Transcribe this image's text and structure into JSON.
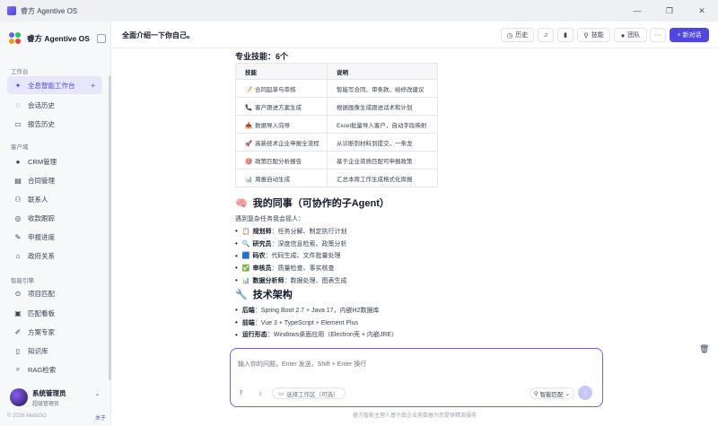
{
  "window": {
    "title": "睿方 Agentive OS"
  },
  "brand": {
    "name": "睿方 Agentive OS"
  },
  "sidebar": {
    "section1": "工作台",
    "section2": "客户域",
    "section3": "智能引擎",
    "items": [
      {
        "label": "全息智能工作台",
        "icon": "sparkle-icon",
        "active": true
      },
      {
        "label": "会话历史",
        "icon": "chat-icon"
      },
      {
        "label": "报告历史",
        "icon": "document-icon"
      },
      {
        "label": "CRM管理",
        "icon": "person-icon"
      },
      {
        "label": "合同管理",
        "icon": "contract-icon"
      },
      {
        "label": "联系人",
        "icon": "contacts-icon"
      },
      {
        "label": "收款跟踪",
        "icon": "payment-icon"
      },
      {
        "label": "申报进度",
        "icon": "progress-icon"
      },
      {
        "label": "政府关系",
        "icon": "government-icon"
      },
      {
        "label": "项目匹配",
        "icon": "match-icon"
      },
      {
        "label": "匹配看板",
        "icon": "board-icon"
      },
      {
        "label": "方案专家",
        "icon": "expert-icon"
      },
      {
        "label": "知识库",
        "icon": "book-icon"
      },
      {
        "label": "RAG检索",
        "icon": "search-icon"
      }
    ],
    "user": {
      "name": "系统管理员",
      "role": "超级管理员"
    },
    "footer": {
      "copyright": "© 2026 MetaGO",
      "about": "关于"
    }
  },
  "header": {
    "title": "全面介绍一下你自己。",
    "history": "历史",
    "skills": "技能",
    "team": "团队",
    "more": "···",
    "new_chat": "+ 新对话"
  },
  "content": {
    "skills_heading": "专业技能：6个",
    "table": {
      "headers": [
        "技能",
        "说明"
      ],
      "rows": [
        {
          "emoji": "📝",
          "skill": "合同起草与审核",
          "desc": "智能写合同、审条款、给修改建议"
        },
        {
          "emoji": "📞",
          "skill": "客户跟进方案生成",
          "desc": "根据画像生成跟进话术和计划"
        },
        {
          "emoji": "📥",
          "skill": "数据导入向导",
          "desc": "Excel批量导入客户，自动字段映射"
        },
        {
          "emoji": "🚀",
          "skill": "高新技术企业申报全流程",
          "desc": "从诊断到材料到提交，一条龙"
        },
        {
          "emoji": "🎯",
          "skill": "政策匹配分析报告",
          "desc": "基于企业资质匹配可申报政策"
        },
        {
          "emoji": "📊",
          "skill": "周报自动生成",
          "desc": "汇总本周工作生成格式化周报"
        }
      ]
    },
    "colleagues_heading": "我的同事（可协作的子Agent）",
    "colleagues_emoji": "🧠",
    "colleagues_intro": "遇到复杂任务我会摇人：",
    "colleagues": [
      {
        "emoji": "📋",
        "role": "规划师",
        "desc": "：任务分解、制定执行计划"
      },
      {
        "emoji": "🔍",
        "role": "研究员",
        "desc": "：深度信息检索、政策分析"
      },
      {
        "emoji": "🟦",
        "role": "码农",
        "desc": "：代码生成、文件批量处理"
      },
      {
        "emoji": "✅",
        "role": "审核员",
        "desc": "：质量检查、事实核查"
      },
      {
        "emoji": "📊",
        "role": "数据分析师",
        "desc": "：数据处理、图表生成"
      }
    ],
    "arch_heading": "技术架构",
    "arch_emoji": "🔧",
    "arch": [
      {
        "key": "后端",
        "value": "：Spring Boot 2.7 + Java 17，内嵌H2数据库"
      },
      {
        "key": "前端",
        "value": "：Vue 3 + TypeScript + Element Plus"
      },
      {
        "key": "运行形态",
        "value": "：Windows桌面应用（Electron壳 + 内嵌JRE）"
      }
    ]
  },
  "input": {
    "placeholder": "输入你的问题，Enter 发送，Shift + Enter 换行",
    "workspace": "选择工作区（可选）",
    "match": "智能匹配"
  },
  "disclaimer": "睿方智能主理人基于政企业务数据为您提供精准服务"
}
